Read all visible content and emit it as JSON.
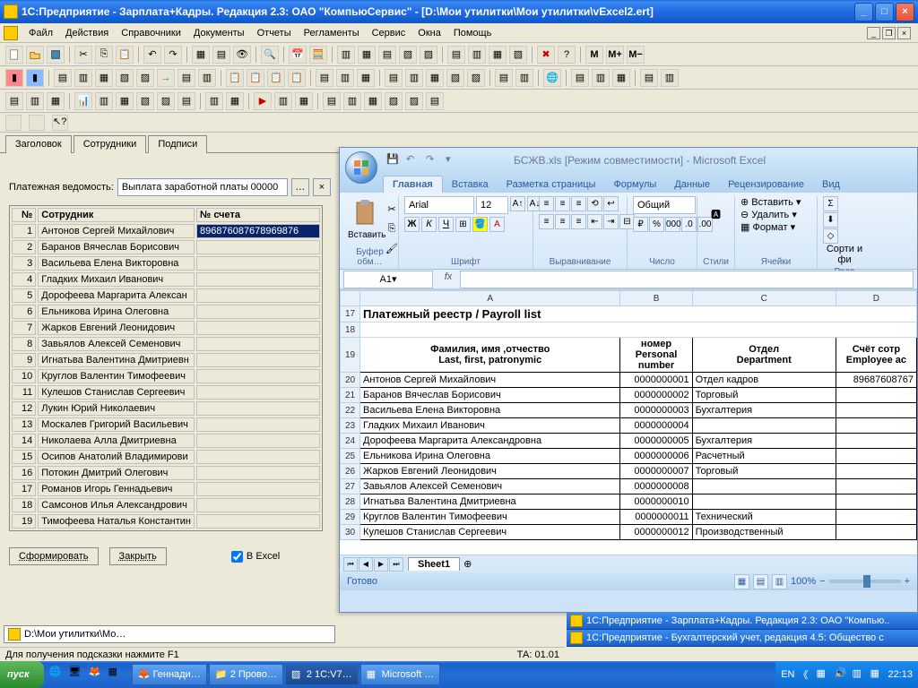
{
  "window": {
    "title": "1С:Предприятие - Зарплата+Кадры. Редакция 2.3: ОАО \"КомпьюСервис\" - [D:\\Мои утилитки\\Мои утилитки\\vExcel2.ert]"
  },
  "menu": [
    "Файл",
    "Действия",
    "Справочники",
    "Документы",
    "Отчеты",
    "Регламенты",
    "Сервис",
    "Окна",
    "Помощь"
  ],
  "tabs1c": {
    "items": [
      "Заголовок",
      "Сотрудники",
      "Подписи"
    ],
    "active": 1
  },
  "form": {
    "vedom_label": "Платежная ведомость:",
    "vedom_value": "Выплата заработной платы 00000",
    "btn_dots": "…",
    "btn_x": "×",
    "form_btn": "Сформировать",
    "close_btn": "Закрыть",
    "excel_chk": "В Excel"
  },
  "table": {
    "headers": {
      "num": "№",
      "emp": "Сотрудник",
      "acct": "№ счета"
    },
    "rows": [
      {
        "n": "1",
        "e": "Антонов Сергей Михайлович",
        "a": "896876087678969876"
      },
      {
        "n": "2",
        "e": "Баранов Вячеслав Борисович",
        "a": ""
      },
      {
        "n": "3",
        "e": "Васильева Елена Викторовна",
        "a": ""
      },
      {
        "n": "4",
        "e": "Гладких Михаил Иванович",
        "a": ""
      },
      {
        "n": "5",
        "e": "Дорофеева Маргарита Алексан",
        "a": ""
      },
      {
        "n": "6",
        "e": "Ельникова Ирина Олеговна",
        "a": ""
      },
      {
        "n": "7",
        "e": "Жарков Евгений Леонидович",
        "a": ""
      },
      {
        "n": "8",
        "e": "Завьялов Алексей Семенович",
        "a": ""
      },
      {
        "n": "9",
        "e": "Игнатьва Валентина Дмитриевн",
        "a": ""
      },
      {
        "n": "10",
        "e": "Круглов Валентин Тимофеевич",
        "a": ""
      },
      {
        "n": "11",
        "e": "Кулешов Станислав Сергеевич",
        "a": ""
      },
      {
        "n": "12",
        "e": "Лукин Юрий Николаевич",
        "a": ""
      },
      {
        "n": "13",
        "e": "Москалев Григорий Васильевич",
        "a": ""
      },
      {
        "n": "14",
        "e": "Николаева Алла Дмитриевна",
        "a": ""
      },
      {
        "n": "15",
        "e": "Осипов Анатолий Владимирови",
        "a": ""
      },
      {
        "n": "16",
        "e": "Потокин Дмитрий Олегович",
        "a": ""
      },
      {
        "n": "17",
        "e": "Романов Игорь Геннадьевич",
        "a": ""
      },
      {
        "n": "18",
        "e": "Самсонов Илья Александрович",
        "a": ""
      },
      {
        "n": "19",
        "e": "Тимофеева Наталья Константин",
        "a": ""
      }
    ]
  },
  "pathbar": "D:\\Мои утилитки\\Мо…",
  "status": {
    "hint": "Для получения подсказки нажмите F1",
    "right": "ТА: 01.01"
  },
  "excel": {
    "title": "БСЖВ.xls [Режим совместимости] - Microsoft Excel",
    "tabs": [
      "Главная",
      "Вставка",
      "Разметка страницы",
      "Формулы",
      "Данные",
      "Рецензирование",
      "Вид"
    ],
    "ribbon": {
      "paste": "Вставить",
      "clipboard": "Буфер обм…",
      "font": "Arial",
      "size": "12",
      "font_label": "Шрифт",
      "align_label": "Выравнивание",
      "num_combo": "Общий",
      "num_label": "Число",
      "styles": "Стили",
      "insert": "Вставить",
      "delete": "Удалить",
      "format": "Формат",
      "cells": "Ячейки",
      "edit": "Реда",
      "sort": "Сорти и фи"
    },
    "namebox": "A1",
    "cols": [
      "A",
      "B",
      "C",
      "D"
    ],
    "title_row": "Платежный реестр /  Payroll list",
    "headers": {
      "name": "Фамилия, имя ,отчество",
      "name2": "Last, first, patronymic",
      "num": "номер",
      "num2": "Personal",
      "num3": "number",
      "dept": "Отдел",
      "dept2": "Department",
      "acct": "Счёт сотр",
      "acct2": "Employee ac"
    },
    "rows": [
      {
        "r": "20",
        "n": "Антонов Сергей Михайлович",
        "p": "0000000001",
        "d": "Отдел кадров",
        "a": "89687608767"
      },
      {
        "r": "21",
        "n": "Баранов Вячеслав Борисович",
        "p": "0000000002",
        "d": "Торговый",
        "a": ""
      },
      {
        "r": "22",
        "n": "Васильева Елена Викторовна",
        "p": "0000000003",
        "d": "Бухгалтерия",
        "a": ""
      },
      {
        "r": "23",
        "n": "Гладких Михаил Иванович",
        "p": "0000000004",
        "d": "",
        "a": ""
      },
      {
        "r": "24",
        "n": "Дорофеева Маргарита Александровна",
        "p": "0000000005",
        "d": "Бухгалтерия",
        "a": ""
      },
      {
        "r": "25",
        "n": "Ельникова Ирина Олеговна",
        "p": "0000000006",
        "d": "Расчетный",
        "a": ""
      },
      {
        "r": "26",
        "n": "Жарков Евгений Леонидович",
        "p": "0000000007",
        "d": "Торговый",
        "a": ""
      },
      {
        "r": "27",
        "n": "Завьялов Алексей Семенович",
        "p": "0000000008",
        "d": "",
        "a": ""
      },
      {
        "r": "28",
        "n": "Игнатьва Валентина Дмитриевна",
        "p": "0000000010",
        "d": "",
        "a": ""
      },
      {
        "r": "29",
        "n": "Круглов Валентин Тимофеевич",
        "p": "0000000011",
        "d": "Технический",
        "a": ""
      },
      {
        "r": "30",
        "n": "Кулешов Станислав Сергеевич",
        "p": "0000000012",
        "d": "Производственный",
        "a": ""
      }
    ],
    "sheet": "Sheet1",
    "status": "Готово",
    "zoom": "100%"
  },
  "notif": [
    "1С:Предприятие - Зарплата+Кадры. Редакция 2.3: ОАО \"Компью..",
    "1С:Предприятие - Бухгалтерский учет, редакция 4.5: Общество с"
  ],
  "taskbar": {
    "start": "пуск",
    "tasks": [
      "Геннади…",
      "2 Прово…",
      "2 1C:V7…",
      "Microsoft …"
    ],
    "lang": "EN",
    "time": "22:13"
  }
}
